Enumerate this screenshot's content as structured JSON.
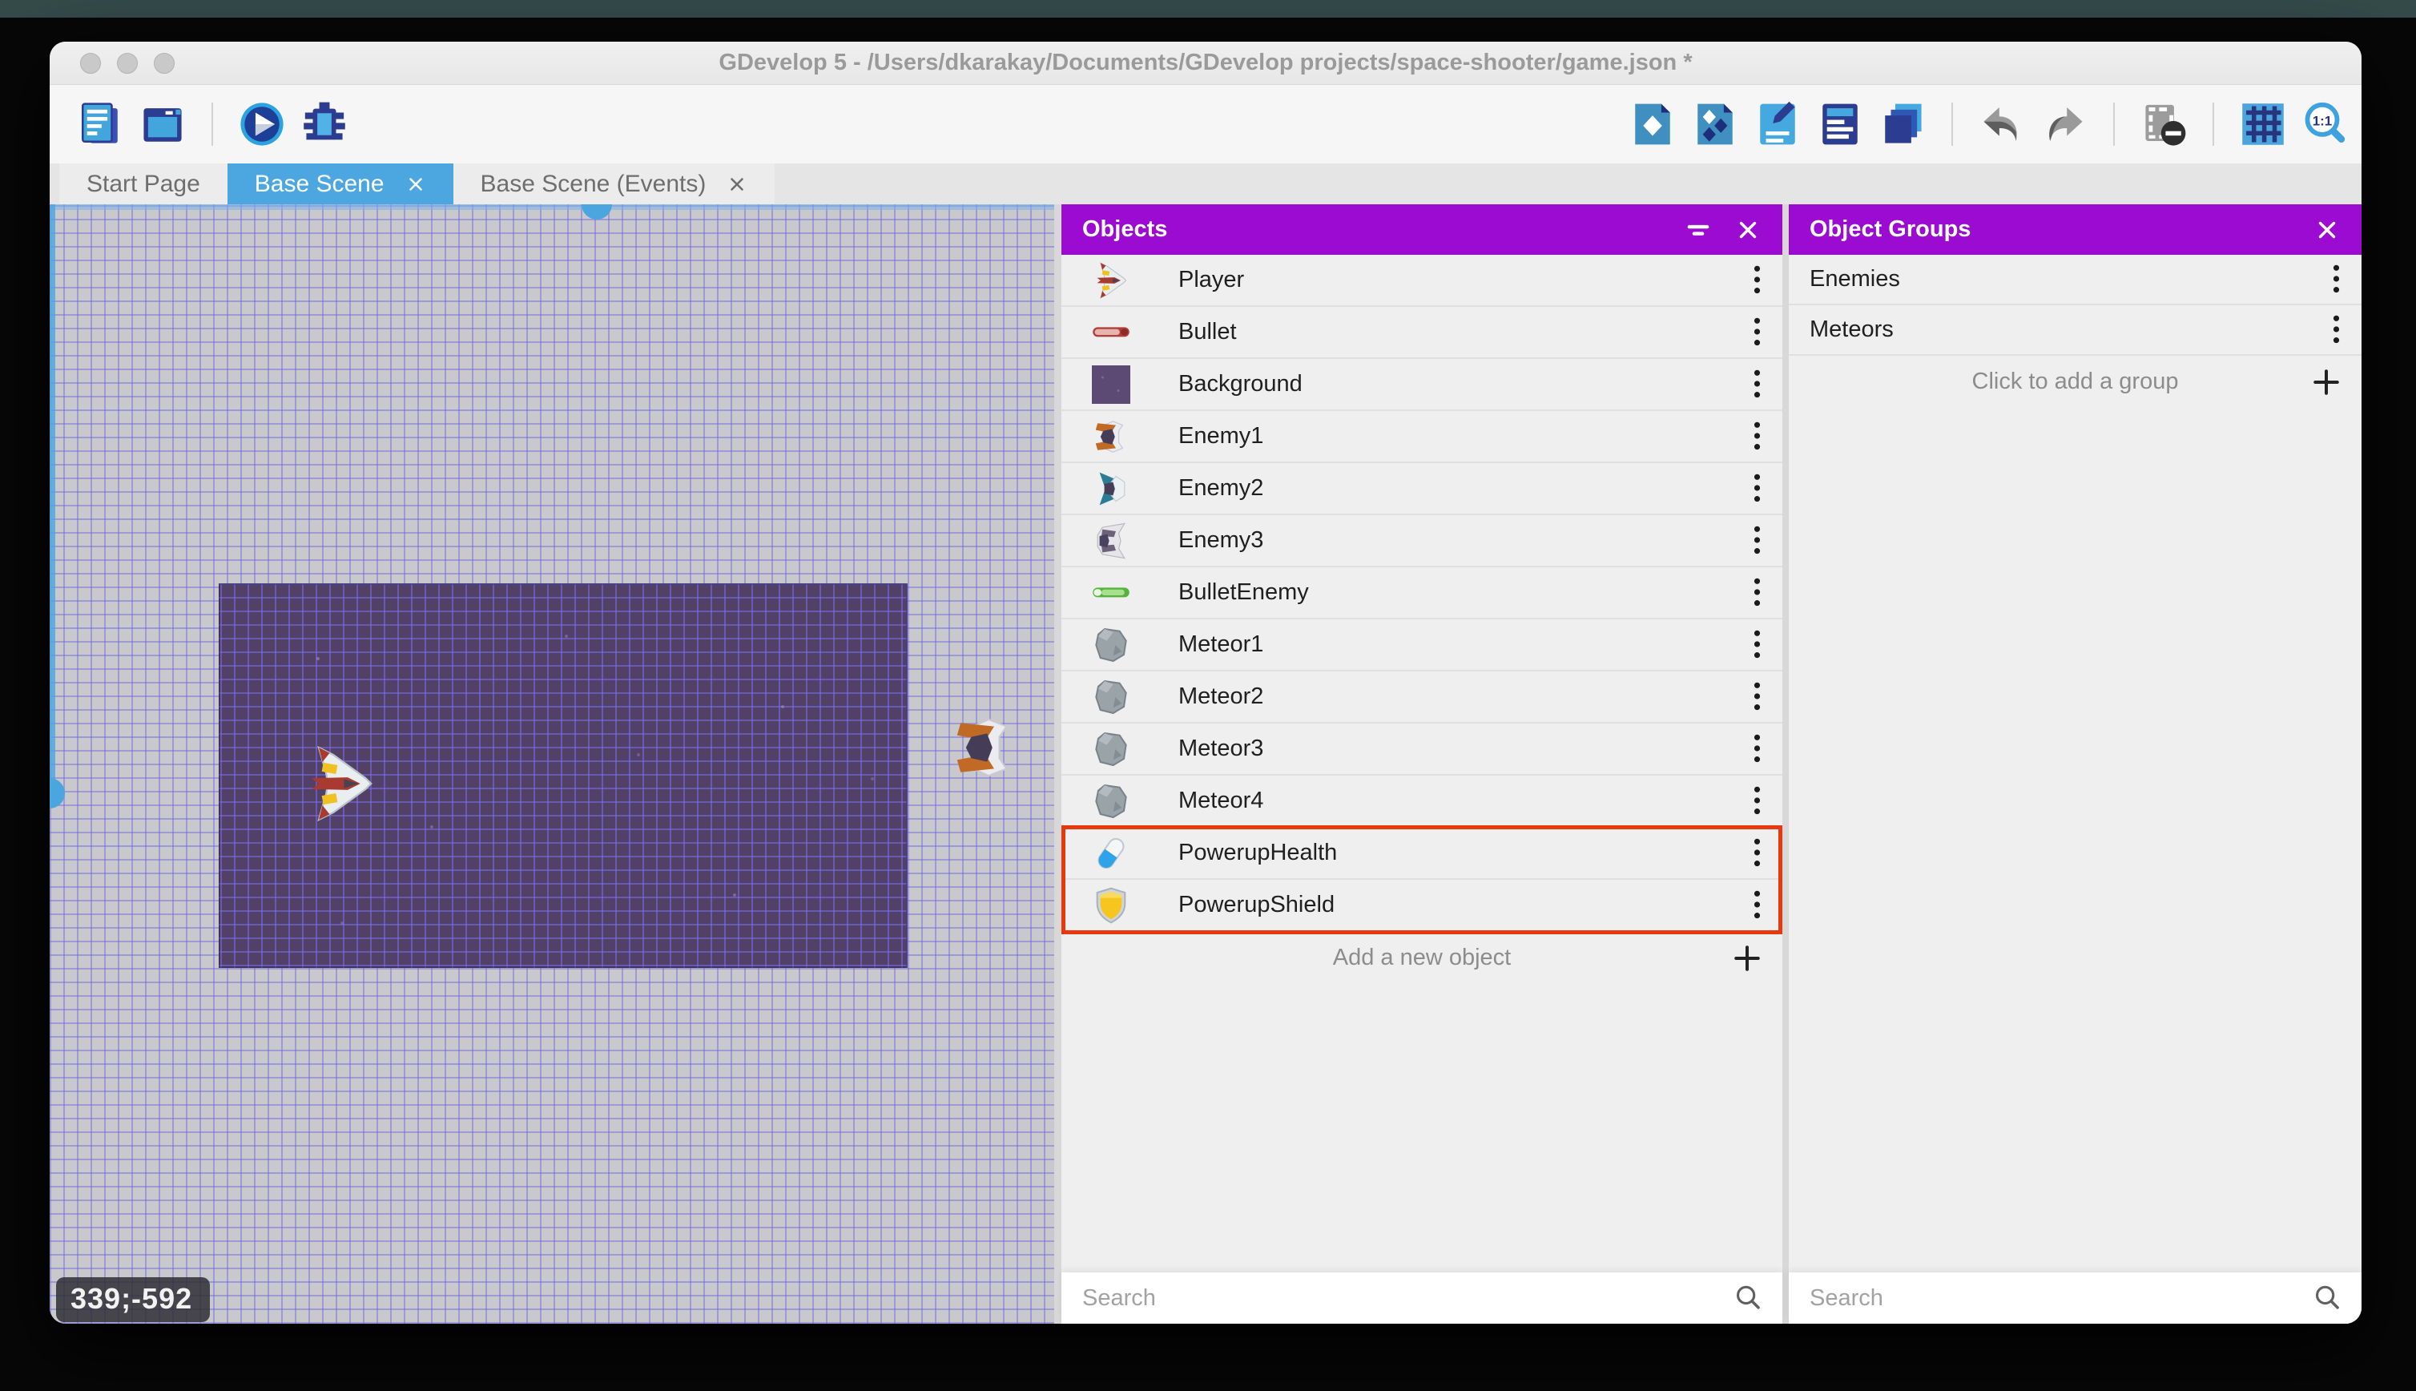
{
  "window": {
    "title": "GDevelop 5 - /Users/dkarakay/Documents/GDevelop projects/space-shooter/game.json *"
  },
  "toolbar": {
    "left_icons": [
      "project-manager-icon",
      "windowed-preview-icon",
      "divider",
      "play-icon",
      "debug-icon"
    ],
    "right_icons": [
      "objects-panel-icon",
      "object-groups-icon",
      "properties-icon",
      "instances-list-icon",
      "layers-icon",
      "divider",
      "undo-icon",
      "redo-icon",
      "divider",
      "mask-icon",
      "divider",
      "grid-icon",
      "zoom-1-1-icon"
    ]
  },
  "tabs": [
    {
      "label": "Start Page",
      "active": false,
      "closable": false
    },
    {
      "label": "Base Scene",
      "active": true,
      "closable": true
    },
    {
      "label": "Base Scene (Events)",
      "active": false,
      "closable": true
    }
  ],
  "canvas": {
    "coordinates": "339;-592",
    "player_sprite_icon": "player-ship-icon",
    "enemy_sprite_icon": "enemy1-ship-icon"
  },
  "objects_panel": {
    "title": "Objects",
    "header_icons": [
      "filter-icon",
      "close-icon"
    ],
    "items": [
      {
        "label": "Player",
        "icon": "player-ship-icon",
        "highlighted": false
      },
      {
        "label": "Bullet",
        "icon": "bullet-icon",
        "highlighted": false
      },
      {
        "label": "Background",
        "icon": "background-icon",
        "highlighted": false
      },
      {
        "label": "Enemy1",
        "icon": "enemy1-ship-icon",
        "highlighted": false
      },
      {
        "label": "Enemy2",
        "icon": "enemy2-ship-icon",
        "highlighted": false
      },
      {
        "label": "Enemy3",
        "icon": "enemy3-ship-icon",
        "highlighted": false
      },
      {
        "label": "BulletEnemy",
        "icon": "bullet-enemy-icon",
        "highlighted": false
      },
      {
        "label": "Meteor1",
        "icon": "meteor-icon",
        "highlighted": false
      },
      {
        "label": "Meteor2",
        "icon": "meteor-icon",
        "highlighted": false
      },
      {
        "label": "Meteor3",
        "icon": "meteor-icon",
        "highlighted": false
      },
      {
        "label": "Meteor4",
        "icon": "meteor-icon",
        "highlighted": false
      },
      {
        "label": "PowerupHealth",
        "icon": "powerup-health-icon",
        "highlighted": true
      },
      {
        "label": "PowerupShield",
        "icon": "powerup-shield-icon",
        "highlighted": true
      }
    ],
    "add_label": "Add a new object",
    "search_placeholder": "Search",
    "highlight_color": "#e8380d"
  },
  "groups_panel": {
    "title": "Object Groups",
    "header_icons": [
      "close-icon"
    ],
    "items": [
      {
        "label": "Enemies"
      },
      {
        "label": "Meteors"
      }
    ],
    "add_label": "Click to add a group",
    "search_placeholder": "Search"
  },
  "colors": {
    "panel_header": "#9c0bd1",
    "active_tab": "#4ca6df",
    "highlight": "#e8380d",
    "scrollbar": "#4ba5de"
  }
}
